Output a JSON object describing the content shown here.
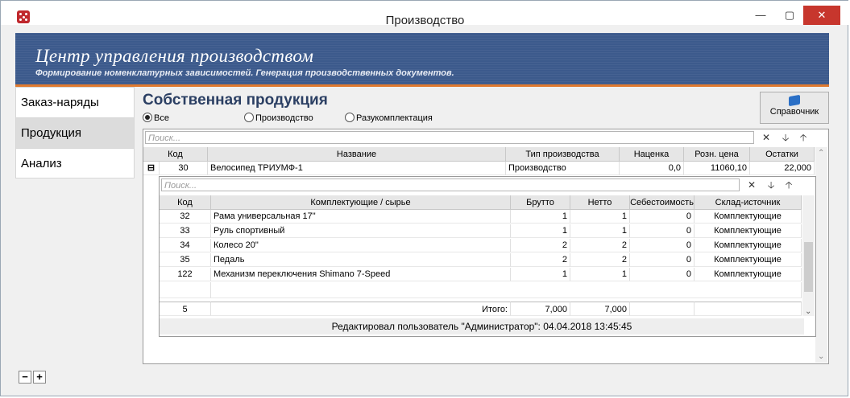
{
  "window": {
    "title": "Производство"
  },
  "header": {
    "title": "Центр управления производством",
    "subtitle": "Формирование номенклатурных зависимостей. Генерация производственных документов."
  },
  "sidebar": {
    "items": [
      {
        "label": "Заказ-наряды"
      },
      {
        "label": "Продукция"
      },
      {
        "label": "Анализ"
      }
    ]
  },
  "main": {
    "title": "Собственная продукция",
    "radios": [
      "Все",
      "Производство",
      "Разукомплектация"
    ],
    "reference_button": "Справочник",
    "search_placeholder": "Поиск...",
    "columns": [
      "Код",
      "Название",
      "Тип производства",
      "Наценка",
      "Розн. цена",
      "Остатки"
    ],
    "row": {
      "code": "30",
      "name": "Велосипед ТРИУМФ-1",
      "type": "Производство",
      "markup": "0,0",
      "price": "11060,10",
      "stock": "22,000"
    }
  },
  "detail": {
    "search_placeholder": "Поиск...",
    "columns": [
      "Код",
      "Комплектующие / сырье",
      "Брутто",
      "Нетто",
      "Себестоимость",
      "Склад-источник"
    ],
    "rows": [
      {
        "code": "32",
        "name": "Рама универсальная 17\"",
        "gross": "1",
        "net": "1",
        "cost": "0",
        "warehouse": "Комплектующие"
      },
      {
        "code": "33",
        "name": "Руль спортивный",
        "gross": "1",
        "net": "1",
        "cost": "0",
        "warehouse": "Комплектующие"
      },
      {
        "code": "34",
        "name": "Колесо 20\"",
        "gross": "2",
        "net": "2",
        "cost": "0",
        "warehouse": "Комплектующие"
      },
      {
        "code": "35",
        "name": "Педаль",
        "gross": "2",
        "net": "2",
        "cost": "0",
        "warehouse": "Комплектующие"
      },
      {
        "code": "122",
        "name": "Механизм переключения Shimano 7-Speed",
        "gross": "1",
        "net": "1",
        "cost": "0",
        "warehouse": "Комплектующие"
      }
    ],
    "totals": {
      "count": "5",
      "label": "Итого:",
      "gross": "7,000",
      "net": "7,000"
    },
    "edited_note": "Редактировал пользователь \"Администратор\": 04.04.2018 13:45:45"
  }
}
